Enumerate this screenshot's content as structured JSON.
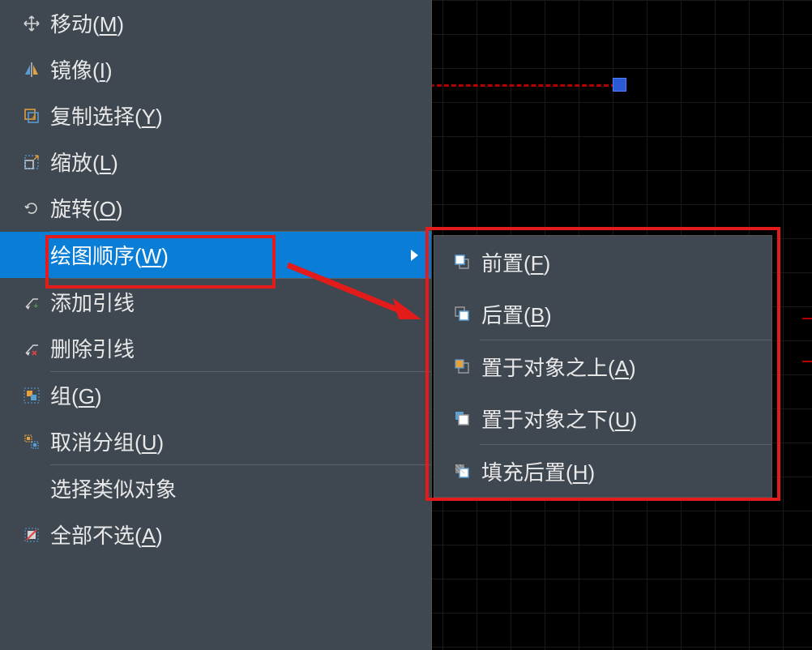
{
  "mainMenu": {
    "items": [
      {
        "label": "移动",
        "shortcut": "M",
        "icon": "move-icon"
      },
      {
        "label": "镜像",
        "shortcut": "I",
        "icon": "mirror-icon"
      },
      {
        "label": "复制选择",
        "shortcut": "Y",
        "icon": "copy-select-icon"
      },
      {
        "label": "缩放",
        "shortcut": "L",
        "icon": "scale-icon"
      },
      {
        "label": "旋转",
        "shortcut": "O",
        "icon": "rotate-icon"
      },
      {
        "label": "绘图顺序",
        "shortcut": "W",
        "icon": "",
        "highlighted": true,
        "hasSubmenu": true
      },
      {
        "label": "添加引线",
        "shortcut": "",
        "icon": "add-leader-icon"
      },
      {
        "label": "删除引线",
        "shortcut": "",
        "icon": "remove-leader-icon"
      },
      {
        "label": "组",
        "shortcut": "G",
        "icon": "group-icon"
      },
      {
        "label": "取消分组",
        "shortcut": "U",
        "icon": "ungroup-icon"
      },
      {
        "label": "选择类似对象",
        "shortcut": "",
        "icon": ""
      },
      {
        "label": "全部不选",
        "shortcut": "A",
        "icon": "deselect-all-icon"
      }
    ]
  },
  "subMenu": {
    "items": [
      {
        "label": "前置",
        "shortcut": "F",
        "icon": "bring-front-icon"
      },
      {
        "label": "后置",
        "shortcut": "B",
        "icon": "send-back-icon"
      },
      {
        "label": "置于对象之上",
        "shortcut": "A",
        "icon": "above-object-icon"
      },
      {
        "label": "置于对象之下",
        "shortcut": "U",
        "icon": "below-object-icon"
      },
      {
        "label": "填充后置",
        "shortcut": "H",
        "icon": "fill-back-icon"
      }
    ]
  },
  "annotation": {
    "mainHighlightBox": true,
    "subHighlightBox": true,
    "arrowColor": "#e31b1b"
  },
  "canvas": {
    "gripColor": "#2a5ad4",
    "lineColor": "#b00000"
  }
}
